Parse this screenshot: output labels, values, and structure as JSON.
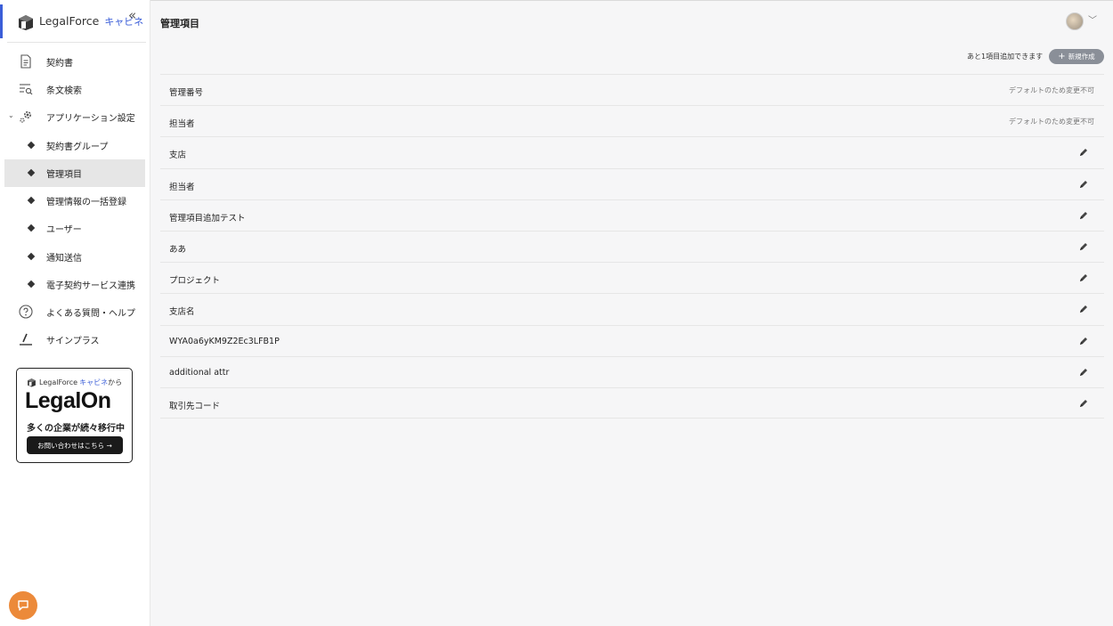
{
  "app": {
    "logo_text": "LegalForce",
    "logo_sub": "キャビネ",
    "collapse_icon": "«"
  },
  "sidebar": {
    "items": [
      {
        "label": "契約書",
        "icon": "document-icon"
      },
      {
        "label": "条文検索",
        "icon": "search-list-icon"
      },
      {
        "label": "アプリケーション設定",
        "icon": "gear-icon",
        "expanded": true
      },
      {
        "label": "契約書グループ",
        "sub": true
      },
      {
        "label": "管理項目",
        "sub": true,
        "active": true
      },
      {
        "label": "管理情報の一括登録",
        "sub": true
      },
      {
        "label": "ユーザー",
        "sub": true
      },
      {
        "label": "通知送信",
        "sub": true
      },
      {
        "label": "電子契約サービス連携",
        "sub": true
      },
      {
        "label": "よくある質問・ヘルプ",
        "icon": "help-icon"
      },
      {
        "label": "サインプラス",
        "icon": "sign-icon"
      }
    ]
  },
  "promo": {
    "top_brand": "LegalForce",
    "top_sub": "キャビネ",
    "top_suffix": "から",
    "brand": "LegalOn",
    "tagline": "多くの企業が続々移行中",
    "cta": "お問い合わせはこちら →"
  },
  "header": {
    "title": "管理項目"
  },
  "toolbar": {
    "remaining_text": "あと1項目追加できます",
    "new_label": "新規作成"
  },
  "fields": [
    {
      "name": "管理番号",
      "note": "デフォルトのため変更不可"
    },
    {
      "name": "担当者",
      "note": "デフォルトのため変更不可"
    },
    {
      "name": "支店"
    },
    {
      "name": "担当者"
    },
    {
      "name": "管理項目追加テスト"
    },
    {
      "name": "ああ"
    },
    {
      "name": "プロジェクト"
    },
    {
      "name": "支店名"
    },
    {
      "name": "WYA0a6yKM9Z2Ec3LFB1P"
    },
    {
      "name": "additional attr"
    },
    {
      "name": "取引先コード"
    }
  ],
  "colors": {
    "accent": "#3b5ed8",
    "chat": "#ec8a3a",
    "new_button": "#8a8f98"
  }
}
